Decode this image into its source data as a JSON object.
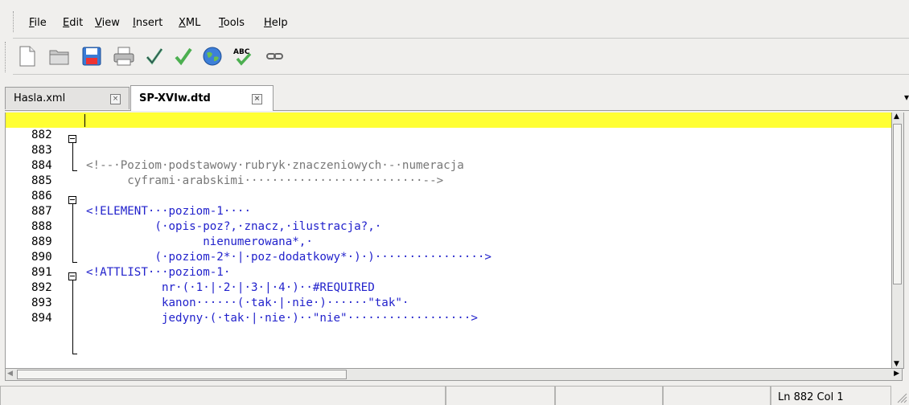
{
  "menu": [
    {
      "label": "File"
    },
    {
      "label": "Edit"
    },
    {
      "label": "View"
    },
    {
      "label": "Insert"
    },
    {
      "label": "XML"
    },
    {
      "label": "Tools"
    },
    {
      "label": "Help"
    }
  ],
  "toolbar": {
    "buttons": [
      "new-file",
      "open-folder",
      "save",
      "print",
      "validate-check",
      "validate-green",
      "globe",
      "spellcheck",
      "link"
    ]
  },
  "tabs": [
    {
      "label": "Hasla.xml",
      "active": false
    },
    {
      "label": "SP-XVIw.dtd",
      "active": true
    }
  ],
  "editor": {
    "lines": [
      {
        "num": "882",
        "text": ""
      },
      {
        "num": "883",
        "text": "<!--·Poziom·podstawowy·rubryk·znaczeniowych·-·numeracja"
      },
      {
        "num": "884",
        "text": "      cyframi·arabskimi··························-->"
      },
      {
        "num": "885",
        "text": ""
      },
      {
        "num": "886",
        "text": "<!ELEMENT···poziom-1····"
      },
      {
        "num": "887",
        "text": "          (·opis-poz?,·znacz,·ilustracja?,·"
      },
      {
        "num": "888",
        "text": "                 nienumerowana*,·"
      },
      {
        "num": "889",
        "text": "          (·poziom-2*·|·poz-dodatkowy*·)·)················>"
      },
      {
        "num": "890",
        "text": "<!ATTLIST···poziom-1·"
      },
      {
        "num": "891",
        "text": "           nr·(·1·|·2·|·3·|·4·)··#REQUIRED"
      },
      {
        "num": "892",
        "text": "           kanon······(·tak·|·nie·)······\"tak\"·"
      },
      {
        "num": "893",
        "text": "           jedyny·(·tak·|·nie·)··\"nie\"··················>"
      },
      {
        "num": "894",
        "text": ""
      }
    ]
  },
  "status": {
    "position": "Ln 882 Col 1"
  }
}
